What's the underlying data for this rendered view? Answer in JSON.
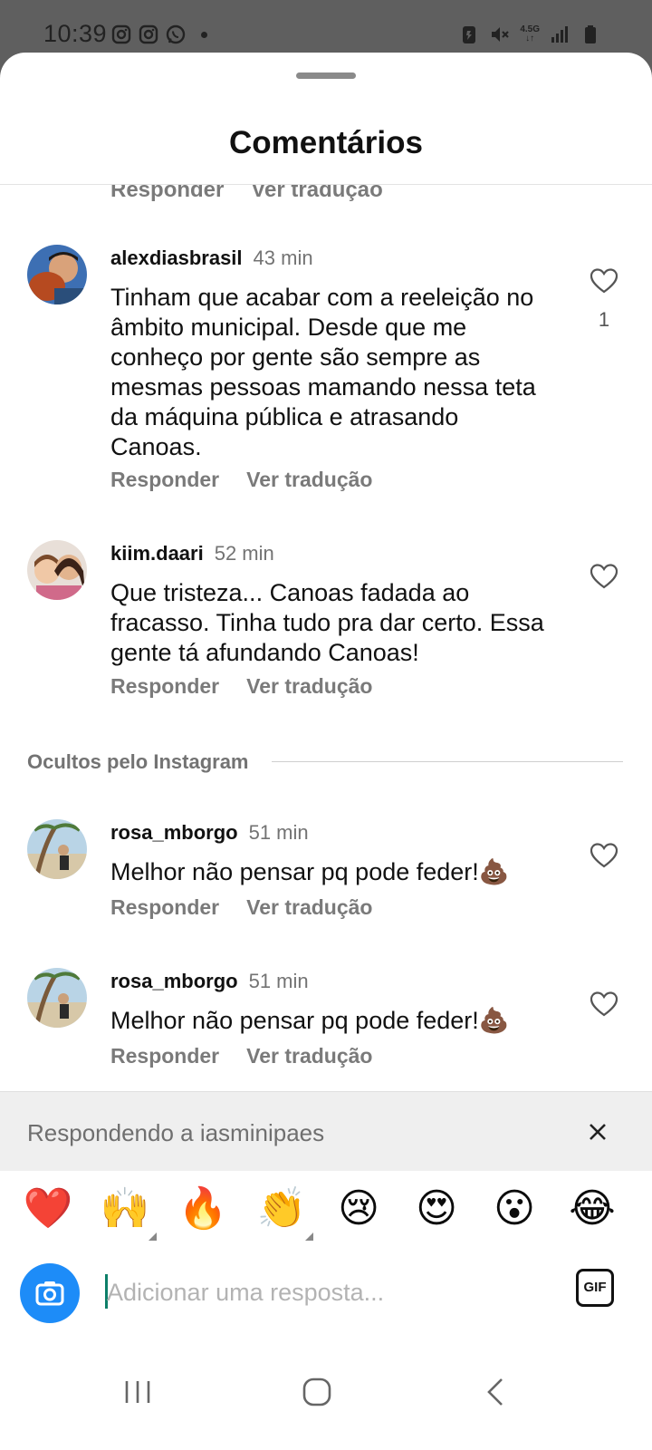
{
  "status_bar": {
    "time": "10:39",
    "left_icons": [
      "instagram-icon",
      "instagram-icon",
      "whatsapp-icon",
      "dot-icon"
    ],
    "right_icons": [
      "battery-saver-icon",
      "mute-icon",
      "network-icon",
      "signal-icon",
      "battery-icon"
    ],
    "network_label": "4.5G"
  },
  "sheet": {
    "title": "Comentários"
  },
  "partial_actions": {
    "reply": "Responder",
    "translate": "Ver tradução"
  },
  "comments": [
    {
      "username": "alexdiasbrasil",
      "time": "43 min",
      "text": "Tinham que acabar com a reeleição no âmbito municipal. Desde que me conheço por gente são sempre as mesmas pessoas mamando nessa teta da máquina pública e atrasando Canoas.",
      "likes": "1",
      "reply": "Responder",
      "translate": "Ver tradução"
    },
    {
      "username": "kiim.daari",
      "time": "52 min",
      "text": "Que tristeza... Canoas fadada ao fracasso. Tinha tudo pra dar certo. Essa gente tá afundando Canoas!",
      "reply": "Responder",
      "translate": "Ver tradução"
    },
    {
      "username": "rosa_mborgo",
      "time": "51 min",
      "text": "Melhor não pensar pq pode feder!💩",
      "reply": "Responder",
      "translate": "Ver tradução"
    },
    {
      "username": "rosa_mborgo",
      "time": "51 min",
      "text": "Melhor não pensar pq pode feder!💩",
      "reply": "Responder",
      "translate": "Ver tradução"
    }
  ],
  "hidden_section": {
    "label": "Ocultos pelo Instagram"
  },
  "reply_bar": {
    "text": "Respondendo a iasminipaes"
  },
  "emoji_bar": {
    "emojis": [
      "❤️",
      "🙌",
      "🔥",
      "👏",
      "😢",
      "😍",
      "😮",
      "😂"
    ]
  },
  "composer": {
    "placeholder": "Adicionar uma resposta...",
    "gif_label": "GIF"
  },
  "colors": {
    "accent": "#1d8cf8",
    "muted": "#737373",
    "reply_bar_bg": "#efefef",
    "status_bg": "#5f5f5f"
  }
}
